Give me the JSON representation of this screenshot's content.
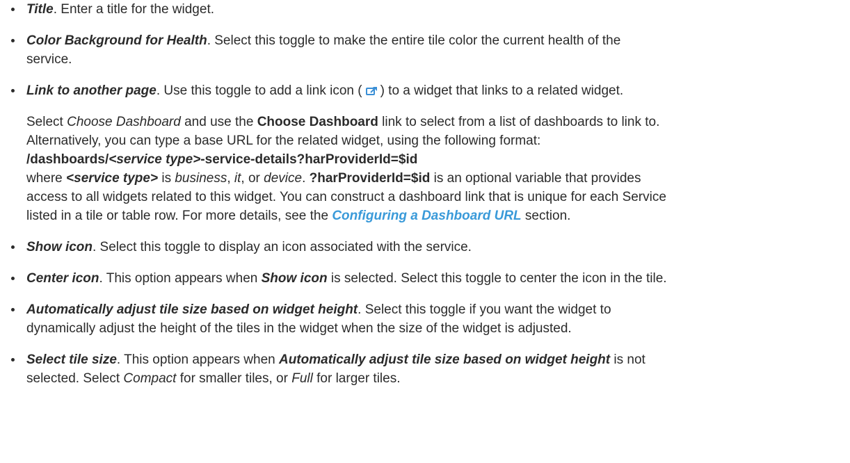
{
  "items": {
    "title": {
      "term": "Title",
      "text": ". Enter a title for the widget."
    },
    "color_bg": {
      "term": "Color Background for Health",
      "text_line1": ". Select this toggle to make the entire tile color the current health of the",
      "text_line2": "service."
    },
    "link_page": {
      "term": "Link to another page",
      "text_before_icon": ". Use this toggle to add a link icon (",
      "icon": "external-link-icon",
      "text_after_icon": ") to a widget that links to a related widget.",
      "para1_a": "Select ",
      "para1_b": "Choose Dashboard",
      "para1_c": " and use the ",
      "para1_d": "Choose Dashboard",
      "para1_e": " link to select from a list of dashboards to link to.",
      "para1_line2": "Alternatively, you can type a base URL for the related widget, using the following format:",
      "url_a": "/dashboards/",
      "url_b": "<service type>",
      "url_c": "-service-details?harProviderId=$id",
      "where_a": "where ",
      "where_b": "<service type>",
      "where_c": " is ",
      "where_d": "business",
      "where_e": ", ",
      "where_f": "it",
      "where_g": ", or ",
      "where_h": "device",
      "where_i": ". ",
      "where_j": "?harProviderId=$id",
      "where_k": " is an optional variable that provides",
      "line_access": "access to all widgets related to this widget. You can construct a dashboard link that is unique for each Service",
      "line_listed_a": "listed in a tile or table row. For more details, see the ",
      "line_listed_link": "Configuring a Dashboard URL",
      "line_listed_b": " section."
    },
    "show_icon": {
      "term": "Show icon",
      "text": ". Select this toggle to display an icon associated with the service."
    },
    "center_icon": {
      "term": "Center icon",
      "text_a": ". This option appears when ",
      "text_b": "Show icon",
      "text_c": " is selected. Select this toggle to center the icon in the tile."
    },
    "auto_adjust": {
      "term": "Automatically adjust tile size based on widget height",
      "text_line1": ". Select this toggle if you want the widget to",
      "text_line2": "dynamically adjust the height of the tiles in the widget when the size of the widget is adjusted."
    },
    "select_size": {
      "term": "Select tile size",
      "text_a": ". This option appears when ",
      "text_b": "Automatically adjust tile size based on widget height",
      "text_c": " is not",
      "line2_a": "selected. Select ",
      "line2_b": "Compact",
      "line2_c": " for smaller tiles, or ",
      "line2_d": "Full",
      "line2_e": " for larger tiles."
    }
  },
  "colors": {
    "text": "#2b2b2b",
    "link": "#3a9ad9",
    "icon_fill": "#3a8fd6"
  }
}
